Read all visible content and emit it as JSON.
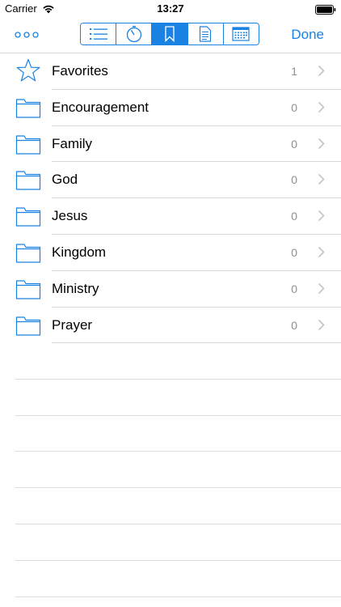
{
  "status_bar": {
    "carrier": "Carrier",
    "time": "13:27"
  },
  "nav": {
    "done_label": "Done",
    "segments": [
      {
        "icon": "list-icon",
        "active": false
      },
      {
        "icon": "timer-icon",
        "active": false
      },
      {
        "icon": "bookmark-icon",
        "active": true
      },
      {
        "icon": "document-icon",
        "active": false
      },
      {
        "icon": "calendar-icon",
        "active": false
      }
    ]
  },
  "accent_color": "#1a82e2",
  "folders": [
    {
      "label": "Favorites",
      "count": "1",
      "icon": "star-icon"
    },
    {
      "label": "Encouragement",
      "count": "0",
      "icon": "folder-icon"
    },
    {
      "label": "Family",
      "count": "0",
      "icon": "folder-icon"
    },
    {
      "label": "God",
      "count": "0",
      "icon": "folder-icon"
    },
    {
      "label": "Jesus",
      "count": "0",
      "icon": "folder-icon"
    },
    {
      "label": "Kingdom",
      "count": "0",
      "icon": "folder-icon"
    },
    {
      "label": "Ministry",
      "count": "0",
      "icon": "folder-icon"
    },
    {
      "label": "Prayer",
      "count": "0",
      "icon": "folder-icon"
    }
  ]
}
